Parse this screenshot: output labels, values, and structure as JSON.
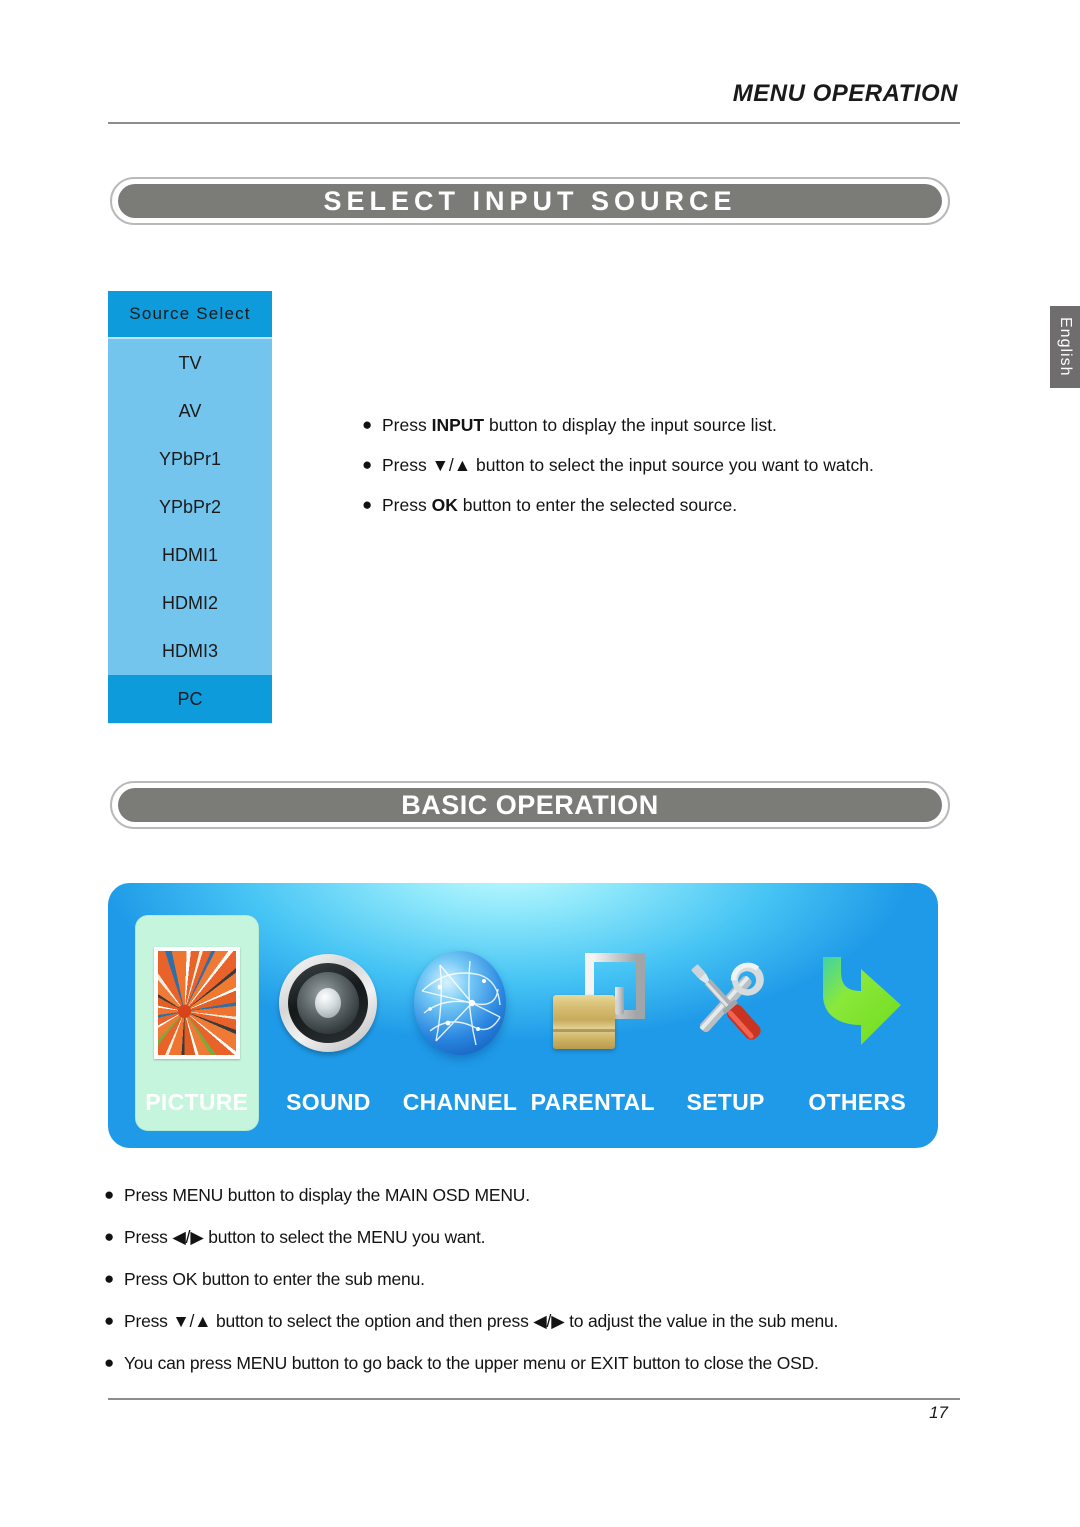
{
  "header": {
    "title": "MENU OPERATION"
  },
  "side_tab": {
    "label": "English"
  },
  "sections": {
    "select_input_source": {
      "banner": "SELECT INPUT SOURCE",
      "osd": {
        "header": "Source Select",
        "items": [
          {
            "label": "TV",
            "selected": false
          },
          {
            "label": "AV",
            "selected": false
          },
          {
            "label": "YPbPr1",
            "selected": false
          },
          {
            "label": "YPbPr2",
            "selected": false
          },
          {
            "label": "HDMI1",
            "selected": false
          },
          {
            "label": "HDMI2",
            "selected": false
          },
          {
            "label": "HDMI3",
            "selected": false
          },
          {
            "label": "PC",
            "selected": true
          }
        ]
      },
      "bullets": [
        {
          "pre": "Press ",
          "bold": "INPUT",
          "post": " button to display the input source list."
        },
        {
          "pre": "Press  ▼/▲ button to select the input source you want to watch.",
          "bold": "",
          "post": ""
        },
        {
          "pre": "Press ",
          "bold": "OK",
          "post": " button to enter the selected source."
        }
      ]
    },
    "basic_operation": {
      "banner": "BASIC OPERATION",
      "osd_menu": [
        {
          "label": "PICTURE",
          "icon": "picture-frame-icon",
          "selected": true
        },
        {
          "label": "SOUND",
          "icon": "speaker-icon",
          "selected": false
        },
        {
          "label": "CHANNEL",
          "icon": "network-globe-icon",
          "selected": false
        },
        {
          "label": "PARENTAL",
          "icon": "open-padlock-icon",
          "selected": false
        },
        {
          "label": "SETUP",
          "icon": "wrench-screwdriver-icon",
          "selected": false
        },
        {
          "label": "OTHERS",
          "icon": "green-arrow-icon",
          "selected": false
        }
      ],
      "bullets": [
        "Press MENU button to display the MAIN OSD MENU.",
        "Press ◀/▶ button to select the MENU you want.",
        "Press OK button to enter the sub menu.",
        "Press ▼/▲ button to select the option and then press ◀/▶ to adjust the value in the sub menu.",
        "You can press MENU button to go back to the upper menu or EXIT button to close the OSD."
      ]
    }
  },
  "footer": {
    "page_number": "17"
  },
  "colors": {
    "banner_fill": "#7b7b78",
    "osd_header_blue": "#0d9bdb",
    "osd_body_blue": "#74c5ee",
    "menu_bg_blue": "#1f9ae8",
    "highlight_green": "#c6f5dd",
    "side_tab_gray": "#6f6d6d"
  }
}
